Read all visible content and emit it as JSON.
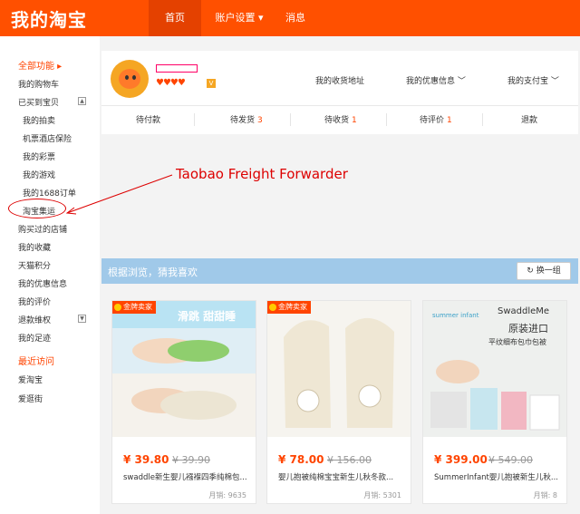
{
  "header": {
    "logo": "我的淘宝",
    "nav": [
      {
        "label": "首页",
        "active": true
      },
      {
        "label": "账户设置 ▾",
        "active": false
      },
      {
        "label": "消息",
        "active": false
      }
    ]
  },
  "sidebar": {
    "all_functions": "全部功能 ▸",
    "items": [
      "我的购物车",
      "已买到宝贝",
      "我的拍卖",
      "机票酒店保险",
      "我的彩票",
      "我的游戏",
      "我的1688订单",
      "淘宝集运",
      "购买过的店铺",
      "我的收藏",
      "天猫积分",
      "我的优惠信息",
      "我的评价",
      "退款维权",
      "我的足迹"
    ],
    "recent_title": "最近访问",
    "recent": [
      "爱淘宝",
      "爱逛街"
    ],
    "toggle_up": "▲",
    "toggle_down": "▼"
  },
  "profile": {
    "hearts": "♥♥♥♥",
    "vip": "V",
    "links": [
      "我的收货地址",
      "我的优惠信息 ﹀",
      "我的支付宝 ﹀"
    ]
  },
  "orders": [
    {
      "label": "待付款",
      "count": ""
    },
    {
      "label": "待发货",
      "count": "3"
    },
    {
      "label": "待收货",
      "count": "1"
    },
    {
      "label": "待评价",
      "count": "1"
    },
    {
      "label": "退款",
      "count": ""
    }
  ],
  "annotation": "Taobao Freight Forwarder",
  "recommend": {
    "title": "根据浏览，猜我喜欢",
    "swap": "↻ 换一组"
  },
  "products": [
    {
      "badge": "金牌卖家",
      "img_text": "滑跳 甜甜睡",
      "price": "¥ 39.80",
      "old_price": "¥ 39.90",
      "title": "swaddle新生婴儿襁褓四季纯棉包...",
      "sales": "月销: 9635"
    },
    {
      "badge": "金牌卖家",
      "img_text": "",
      "price": "¥ 78.00",
      "old_price": "¥ 156.00",
      "title": "婴儿抱被纯棉宝宝新生儿秋冬款...",
      "sales": "月销: 5301"
    },
    {
      "badge": "",
      "img_brand": "summer infant",
      "img_title": "SwaddleMe",
      "img_sub1": "原装进口",
      "img_sub2": "平纹细布包巾包被",
      "price": "¥ 399.00",
      "old_price": "¥ 549.00",
      "title": "SummerInfant婴儿抱被新生儿秋...",
      "sales": "月销: 8"
    }
  ],
  "colors": {
    "brand": "#ff5000",
    "price": "#ff4400",
    "reco_bar": "#a0c9e9"
  }
}
